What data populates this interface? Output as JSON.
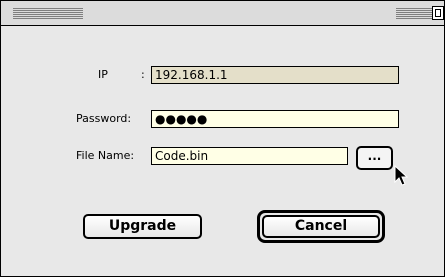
{
  "form": {
    "ip_label": "IP",
    "ip_colon": ":",
    "ip_value": "192.168.1.1",
    "password_label": "Password:",
    "password_value": "●●●●●",
    "filename_label": "File Name:",
    "filename_value": "Code.bin",
    "browse_label": "..."
  },
  "actions": {
    "upgrade_label": "Upgrade",
    "cancel_label": "Cancel"
  },
  "icons": {
    "cursor": "arrow-cursor-icon",
    "zoom": "zoom-box-icon"
  },
  "colors": {
    "window_bg": "#e8e8e8",
    "field_bg": "#ffffe6",
    "disabled_field_bg": "#e4dfc9"
  }
}
